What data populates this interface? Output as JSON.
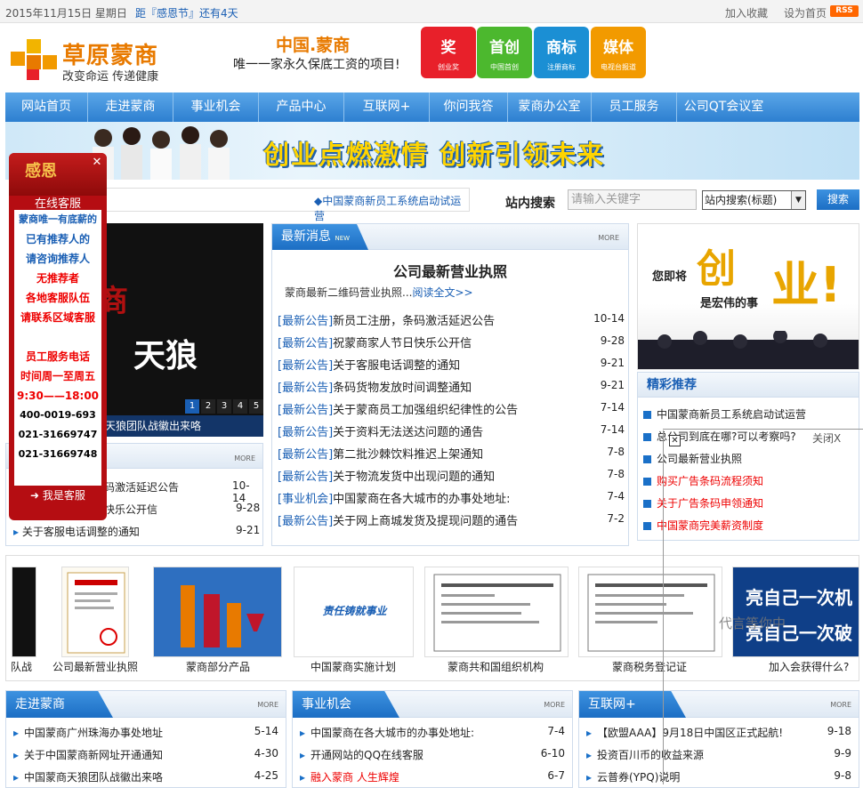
{
  "topbar": {
    "date": "2015年11月15日  星期日",
    "countdown": "距『感恩节』还有4天",
    "favorite": "加入收藏",
    "homepage": "设为首页",
    "rss": "RSS"
  },
  "logo": {
    "brand": "草原蒙商",
    "slogan": "改变命运 传递健康"
  },
  "header": {
    "title": "中国.蒙商",
    "subtitle": "唯一一家永久保底工资的项目!",
    "badges": [
      {
        "title": "奖",
        "sub": "创业奖",
        "color": "#e8202a"
      },
      {
        "title": "首创",
        "sub": "中国首创",
        "color": "#4cb82e"
      },
      {
        "title": "商标",
        "sub": "注册商标",
        "color": "#1b8fd4"
      },
      {
        "title": "媒体",
        "sub": "电视台报道",
        "color": "#f29a00"
      }
    ]
  },
  "nav": {
    "items": [
      "网站首页",
      "走进蒙商",
      "事业机会",
      "产品中心",
      "互联网+",
      "你问我答",
      "蒙商办公室",
      "员工服务",
      "公司QT会议室"
    ]
  },
  "banner": {
    "slogan": "创业点燃激情  创新引领未来"
  },
  "ticker": {
    "text": "◆中国蒙商新员工系统启动试运营"
  },
  "search": {
    "label": "站内搜索",
    "placeholder": "请输入关键字",
    "select": "站内搜索(标题)",
    "button": "搜索"
  },
  "slider": {
    "graphic1": "商",
    "graphic2": "天狼",
    "dots": [
      "1",
      "2",
      "3",
      "4",
      "5"
    ],
    "caption": "天狼团队战徽出来咯"
  },
  "left_list": {
    "more": "MORE",
    "rows": [
      {
        "title": "码激活延迟公告",
        "date": "10-14"
      },
      {
        "title": "快乐公开信",
        "date": "9-28"
      },
      {
        "title": "关于客服电话调整的通知",
        "date": "9-21"
      }
    ]
  },
  "news": {
    "tab": "最新消息",
    "tab_tag": "NEW",
    "more": "MORE",
    "headline": "公司最新营业执照",
    "summary": "蒙商最新二维码营业执照...",
    "readmore": "阅读全文>>",
    "items": [
      {
        "cat": "[最新公告]",
        "title": "新员工注册，条码激活延迟公告",
        "date": "10-14"
      },
      {
        "cat": "[最新公告]",
        "title": "祝蒙商家人节日快乐公开信",
        "date": "9-28"
      },
      {
        "cat": "[最新公告]",
        "title": "关于客服电话调整的通知",
        "date": "9-21"
      },
      {
        "cat": "[最新公告]",
        "title": "条码货物发放时间调整通知",
        "date": "9-21"
      },
      {
        "cat": "[最新公告]",
        "title": "关于蒙商员工加强组织纪律性的公告",
        "date": "7-14"
      },
      {
        "cat": "[最新公告]",
        "title": "关于资料无法送达问题的通告",
        "date": "7-14"
      },
      {
        "cat": "[最新公告]",
        "title": "第二批沙棘饮料推迟上架通知",
        "date": "7-8"
      },
      {
        "cat": "[最新公告]",
        "title": "关于物流发货中出现问题的通知",
        "date": "7-8"
      },
      {
        "cat": "[事业机会]",
        "title": "中国蒙商在各大城市的办事处地址:",
        "date": "7-4"
      },
      {
        "cat": "[最新公告]",
        "title": "关于网上商城发货及提现问题的通告",
        "date": "7-2"
      }
    ]
  },
  "right_pic": {
    "t1": "您即将",
    "t2": "创",
    "t3": "业!",
    "t4": "是宏伟的事"
  },
  "recommend": {
    "title": "精彩推荐",
    "items": [
      {
        "text": "中国蒙商新员工系统启动试运营",
        "red": false
      },
      {
        "text": "总公司到底在哪?可以考察吗?",
        "red": false
      },
      {
        "text": "公司最新营业执照",
        "red": false
      },
      {
        "text": "购买广告条码流程须知",
        "red": true
      },
      {
        "text": "关于广告条码申领通知",
        "red": true
      },
      {
        "text": "中国蒙商完美薪资制度",
        "red": true
      }
    ]
  },
  "gallery": {
    "items": [
      "队战",
      "公司最新营业执照",
      "蒙商部分产品",
      "中国蒙商实施计划",
      "蒙商共和国组织机构",
      "蒙商税务登记证",
      "加入会获得什么?"
    ],
    "plan_sign": "责任铸就事业",
    "bright_text": "亮自己一次机",
    "bright_text2": "亮自己一次破"
  },
  "bottom": [
    {
      "tab": "走进蒙商",
      "more": "MORE",
      "items": [
        {
          "title": "中国蒙商广州珠海办事处地址",
          "date": "5-14",
          "red": false
        },
        {
          "title": "关于中国蒙商新网址开通通知",
          "date": "4-30",
          "red": false
        },
        {
          "title": "中国蒙商天狼团队战徽出来咯",
          "date": "4-25",
          "red": false
        }
      ]
    },
    {
      "tab": "事业机会",
      "more": "MORE",
      "items": [
        {
          "title": "中国蒙商在各大城市的办事处地址:",
          "date": "7-4",
          "red": false
        },
        {
          "title": "开通网站的QQ在线客服",
          "date": "6-10",
          "red": false
        },
        {
          "title": "融入蒙商  人生辉煌",
          "date": "6-7",
          "red": true
        }
      ]
    },
    {
      "tab": "互联网+",
      "more": "MORE",
      "items": [
        {
          "title": "【欧盟AAA】9月18日中国区正式起航!",
          "date": "9-18",
          "red": false
        },
        {
          "title": "投资百川币的收益来源",
          "date": "9-9",
          "red": false
        },
        {
          "title": "云普券(YPQ)说明",
          "date": "9-8",
          "red": false
        }
      ]
    }
  ],
  "kefu": {
    "greeting": "感恩",
    "online": "在线客服",
    "lines": [
      {
        "text": "蒙商唯一有底薪的",
        "color": "#1a5fb4"
      },
      {
        "text": "已有推荐人的",
        "color": "#1a5fb4"
      },
      {
        "text": "请咨询推荐人",
        "color": "#1a5fb4"
      },
      {
        "text": "无推荐者",
        "color": "#e00000"
      },
      {
        "text": "各地客服队伍",
        "color": "#e00000"
      },
      {
        "text": "请联系区域客服",
        "color": "#e00000"
      },
      {
        "text": "",
        "color": "#000"
      },
      {
        "text": "员工服务电话",
        "color": "#e00000"
      },
      {
        "text": "时间周一至周五",
        "color": "#e00000"
      },
      {
        "text": "9:30——18:00",
        "color": "#e00000"
      },
      {
        "text": "400-0019-693",
        "color": "#000"
      },
      {
        "text": "021-31669747",
        "color": "#000"
      },
      {
        "text": "021-31669748",
        "color": "#000"
      }
    ],
    "me": "我是客服"
  },
  "ad": {
    "close": "关闭X",
    "wait": "代言等你中"
  }
}
